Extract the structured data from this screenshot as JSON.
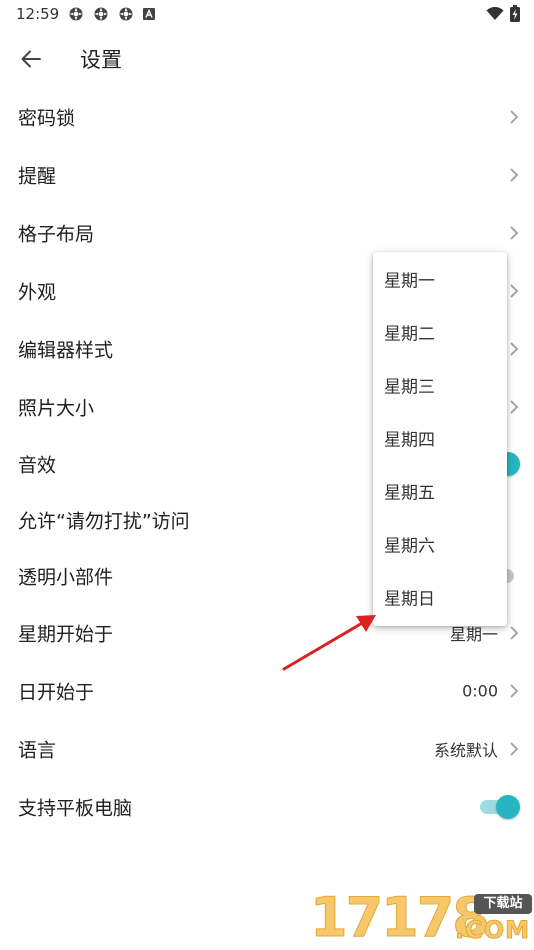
{
  "status_bar": {
    "time": "12:59",
    "left_icons": [
      "settings-gear-icon",
      "settings-gear-icon",
      "settings-gear-icon",
      "a-box-icon"
    ],
    "right_icons": [
      "wifi-icon",
      "battery-charging-icon"
    ]
  },
  "header": {
    "back_icon": "arrow-left-icon",
    "title": "设置"
  },
  "settings": {
    "items": [
      {
        "label": "密码锁",
        "control": "chevron"
      },
      {
        "label": "提醒",
        "control": "chevron"
      },
      {
        "label": "格子布局",
        "control": "chevron"
      },
      {
        "label": "外观",
        "control": "chevron"
      },
      {
        "label": "编辑器样式",
        "control": "chevron"
      },
      {
        "label": "照片大小",
        "control": "chevron"
      },
      {
        "label": "音效",
        "control": "toggle",
        "on": true
      },
      {
        "label": "允许“请勿打扰”访问",
        "control": "none"
      },
      {
        "label": "透明小部件",
        "control": "toggle",
        "on": false
      },
      {
        "label": "星期开始于",
        "control": "chevron",
        "value": "星期一"
      },
      {
        "label": "日开始于",
        "control": "chevron",
        "value": "0:00"
      },
      {
        "label": "语言",
        "control": "chevron",
        "value": "系统默认"
      },
      {
        "label": "支持平板电脑",
        "control": "toggle",
        "on": true
      }
    ]
  },
  "week_start_menu": {
    "options": [
      "星期一",
      "星期二",
      "星期三",
      "星期四",
      "星期五",
      "星期六",
      "星期日"
    ]
  },
  "annotation": {
    "color": "#d92323"
  },
  "watermark": {
    "digits": "17178",
    "badge": "下载站",
    "suffix": ".COM"
  },
  "colors": {
    "accent": "#26b5c2",
    "accent_track": "#9fdbe0",
    "text": "#212121"
  }
}
